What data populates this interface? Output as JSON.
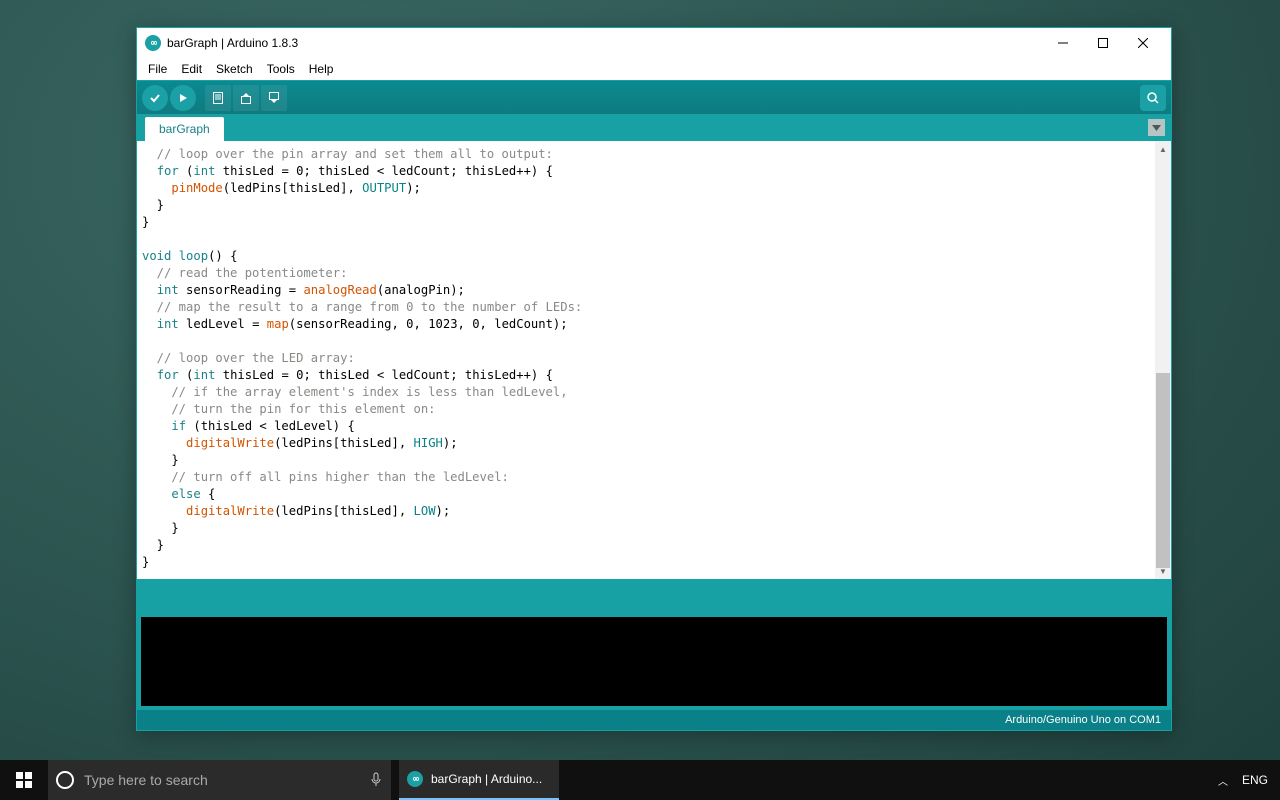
{
  "window": {
    "title": "barGraph | Arduino 1.8.3"
  },
  "menu": {
    "file": "File",
    "edit": "Edit",
    "sketch": "Sketch",
    "tools": "Tools",
    "help": "Help"
  },
  "tab": {
    "name": "barGraph"
  },
  "statusbar": {
    "board": "Arduino/Genuino Uno on COM1"
  },
  "code": {
    "l1": "  // loop over the pin array and set them all to output:",
    "l2_a": "  ",
    "l2_b": "for",
    "l2_c": " (",
    "l2_d": "int",
    "l2_e": " thisLed = 0; thisLed < ledCount; thisLed++) {",
    "l3_a": "    ",
    "l3_b": "pinMode",
    "l3_c": "(ledPins[thisLed], ",
    "l3_d": "OUTPUT",
    "l3_e": ");",
    "l4": "  }",
    "l5": "}",
    "l6": "",
    "l7_a": "void",
    "l7_b": " ",
    "l7_c": "loop",
    "l7_d": "() {",
    "l8": "  // read the potentiometer:",
    "l9_a": "  ",
    "l9_b": "int",
    "l9_c": " sensorReading = ",
    "l9_d": "analogRead",
    "l9_e": "(analogPin);",
    "l10": "  // map the result to a range from 0 to the number of LEDs:",
    "l11_a": "  ",
    "l11_b": "int",
    "l11_c": " ledLevel = ",
    "l11_d": "map",
    "l11_e": "(sensorReading, 0, 1023, 0, ledCount);",
    "l12": "",
    "l13": "  // loop over the LED array:",
    "l14_a": "  ",
    "l14_b": "for",
    "l14_c": " (",
    "l14_d": "int",
    "l14_e": " thisLed = 0; thisLed < ledCount; thisLed++) {",
    "l15": "    // if the array element's index is less than ledLevel,",
    "l16": "    // turn the pin for this element on:",
    "l17_a": "    ",
    "l17_b": "if",
    "l17_c": " (thisLed < ledLevel) {",
    "l18_a": "      ",
    "l18_b": "digitalWrite",
    "l18_c": "(ledPins[thisLed], ",
    "l18_d": "HIGH",
    "l18_e": ");",
    "l19": "    }",
    "l20": "    // turn off all pins higher than the ledLevel:",
    "l21_a": "    ",
    "l21_b": "else",
    "l21_c": " {",
    "l22_a": "      ",
    "l22_b": "digitalWrite",
    "l22_c": "(ledPins[thisLed], ",
    "l22_d": "LOW",
    "l22_e": ");",
    "l23": "    }",
    "l24": "  }",
    "l25": "}"
  },
  "taskbar": {
    "search_placeholder": "Type here to search",
    "task1": "barGraph | Arduino...",
    "lang": "ENG"
  }
}
